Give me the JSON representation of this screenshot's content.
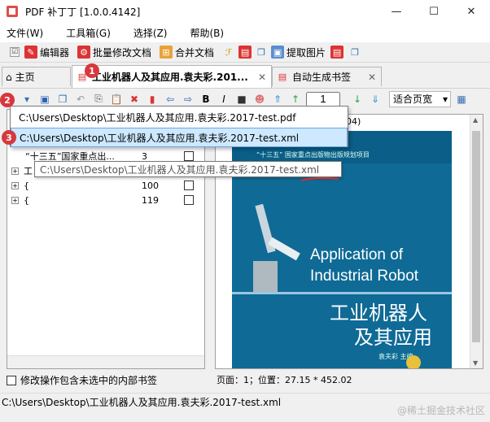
{
  "window": {
    "title": "PDF 补丁丁 [1.0.0.4142]",
    "minimize": "—",
    "maximize": "☐",
    "close": "✕"
  },
  "menu": [
    "文件(W)",
    "工具箱(G)",
    "选择(Z)",
    "帮助(B)"
  ],
  "toolbar1": {
    "editor": "编辑器",
    "batch": "批量修改文档",
    "merge": "合并文档",
    "extract": "提取图片"
  },
  "tabs": {
    "home": "主页",
    "doc": "工业机器人及其应用.袁夫彩.201...",
    "bookmarks": "自动生成书签"
  },
  "toolbar2": {
    "page_value": "1",
    "zoom": "适合页宽"
  },
  "dropdown": {
    "items": [
      "C:\\Users\\Desktop\\工业机器人及其应用.袁夫彩.2017-test.pdf",
      "C:\\Users\\Desktop\\工业机器人及其应用.袁夫彩.2017-test.xml"
    ]
  },
  "tooltip": "C:\\Users\\Desktop\\工业机器人及其应用.袁夫彩.2017-test.xml",
  "tree": {
    "rows": [
      {
        "label": "“十三五”国家重点出...",
        "num": "3"
      },
      {
        "label": "工",
        "num": ""
      },
      {
        "label": "{",
        "num": "100"
      },
      {
        "label": "{",
        "num": "119"
      }
    ]
  },
  "viewer": {
    "partial_header": "04)",
    "book_banner": "“十三五” 国家重点出版物出版规划项目",
    "title_en_1": "Application of",
    "title_en_2": "Industrial Robot",
    "title_cn_1": "工业机器人",
    "title_cn_2": "及其应用",
    "author": "袁夫彩  主编"
  },
  "badges": [
    "1",
    "2",
    "3"
  ],
  "bottom": {
    "checkbox_label": "修改操作包含未选中的内部书签",
    "position": "页面：1；位置：27.15 * 452.02"
  },
  "status": {
    "path": "C:\\Users\\Desktop\\工业机器人及其应用.袁夫彩.2017-test.xml",
    "watermark": "@稀土掘金技术社区"
  }
}
